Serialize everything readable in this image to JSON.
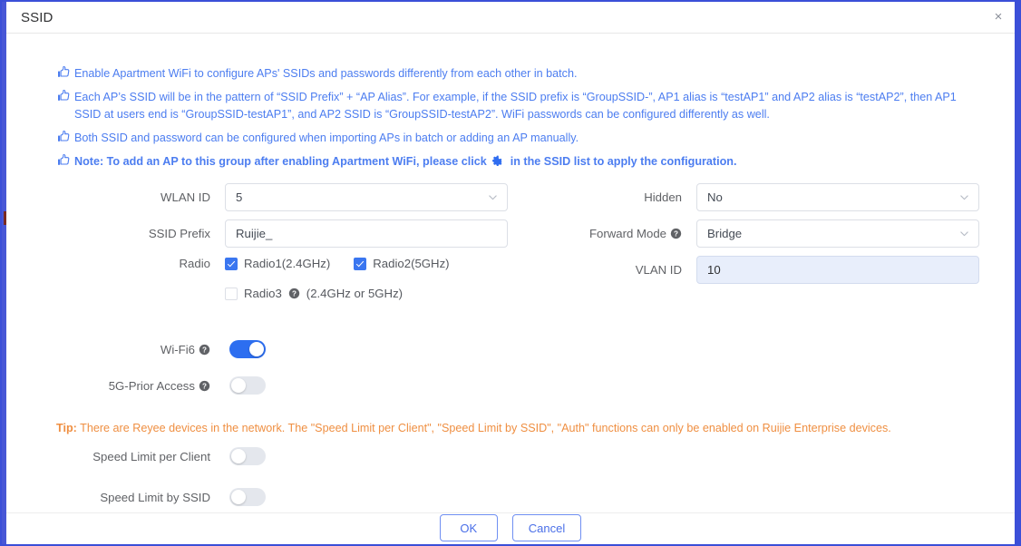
{
  "dialog": {
    "title": "SSID",
    "close_label": "×"
  },
  "info": {
    "bullet_icon": "pointing-hand-icon",
    "lines": [
      {
        "text": "Enable Apartment WiFi to configure APs' SSIDs and passwords differently from each other in batch.",
        "bold": false
      },
      {
        "text": "Each AP’s SSID will be in the pattern of “SSID Prefix” + “AP Alias”. For example, if the SSID prefix is “GroupSSID-”, AP1 alias is “testAP1” and AP2 alias is “testAP2”, then AP1 SSID at users end is “GroupSSID-testAP1”, and AP2 SSID is “GroupSSID-testAP2”. WiFi passwords can be configured differently as well.",
        "bold": false
      },
      {
        "text": "Both SSID and password can be configured when importing APs in batch or adding an AP manually.",
        "bold": false
      }
    ],
    "note": {
      "before_gear": "Note: To add an AP to this group after enabling Apartment WiFi, please click",
      "gear_icon": "gear-icon",
      "after_gear": "in the SSID list to apply the configuration.",
      "bold": true
    }
  },
  "form": {
    "wlan_id": {
      "label": "WLAN ID",
      "value": "5",
      "type": "select"
    },
    "ssid_prefix": {
      "label": "SSID Prefix",
      "value": "Ruijie_",
      "placeholder": "",
      "type": "input"
    },
    "radio": {
      "label": "Radio",
      "options": [
        {
          "label": "Radio1(2.4GHz)",
          "checked": true
        },
        {
          "label": "Radio2(5GHz)",
          "checked": true
        }
      ],
      "radio3": {
        "label": "Radio3",
        "suffix": "(2.4GHz or 5GHz)",
        "checked": false,
        "help_icon": "help-icon"
      }
    },
    "hidden": {
      "label": "Hidden",
      "value": "No",
      "type": "select"
    },
    "forward_mode": {
      "label": "Forward Mode",
      "value": "Bridge",
      "type": "select",
      "help_icon": "help-icon"
    },
    "vlan_id": {
      "label": "VLAN ID",
      "value": "10",
      "type": "input"
    },
    "wifi6": {
      "label": "Wi-Fi6",
      "on": true,
      "help_icon": "help-icon"
    },
    "prior_5g": {
      "label": "5G-Prior Access",
      "on": false,
      "help_icon": "help-icon"
    },
    "speed_limit_client": {
      "label": "Speed Limit per Client",
      "on": false
    },
    "speed_limit_ssid": {
      "label": "Speed Limit by SSID",
      "on": false
    }
  },
  "tip": {
    "prefix": "Tip:",
    "text": " There are Reyee devices in the network. The \"Speed Limit per Client\", \"Speed Limit by SSID\", \"Auth\" functions can only be enabled on Ruijie Enterprise devices."
  },
  "footer": {
    "ok_label": "OK",
    "cancel_label": "Cancel"
  },
  "colors": {
    "info_blue": "#4c7df0",
    "tip_orange": "#ef8f42",
    "accent": "#3a76f0",
    "border_blue": "#3b4fd8"
  }
}
